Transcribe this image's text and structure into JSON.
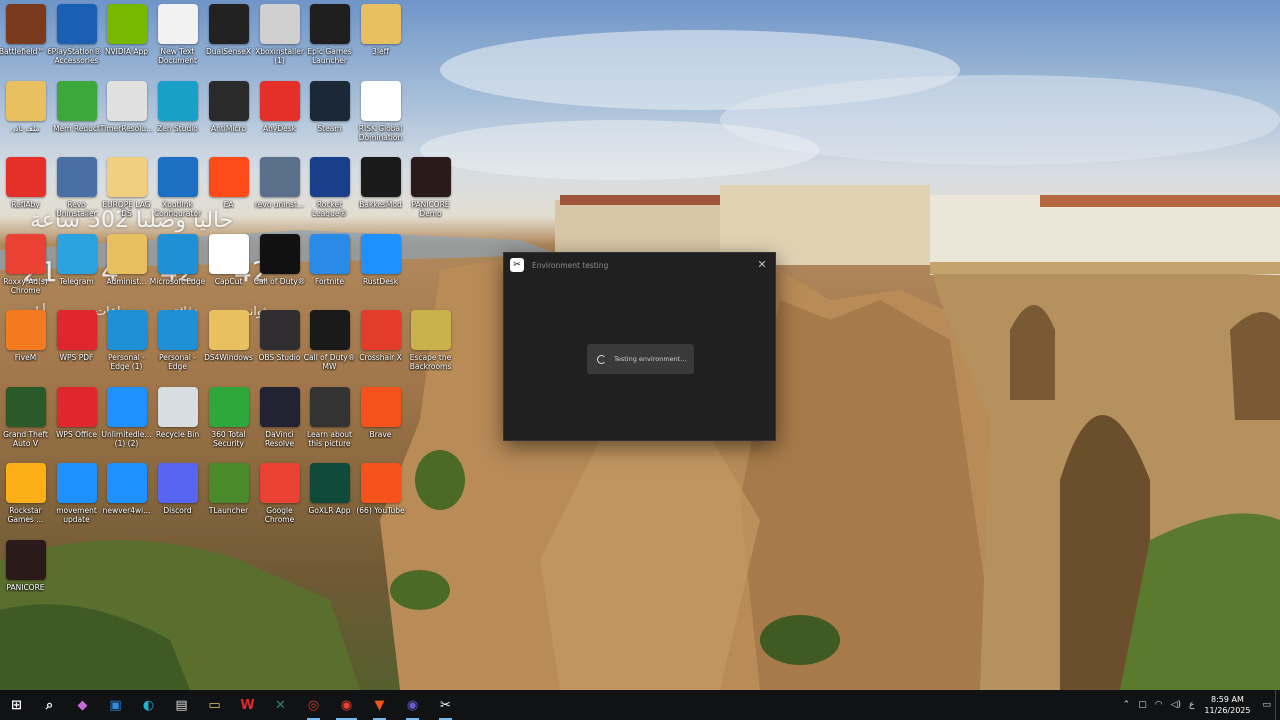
{
  "desktop": {
    "icons": [
      {
        "label": "Battlefield™ 6",
        "icon": "battlefield-icon",
        "color": "#7a3a1e"
      },
      {
        "label": "PlayStation® Accessories",
        "icon": "playstation-icon",
        "color": "#1a5fb4"
      },
      {
        "label": "NVIDIA App",
        "icon": "nvidia-icon",
        "color": "#76b900"
      },
      {
        "label": "New Text Document",
        "icon": "text-file-icon",
        "color": "#f2f2f2"
      },
      {
        "label": "DualSenseX",
        "icon": "dualsense-icon",
        "color": "#222222"
      },
      {
        "label": "Xboxinstaller (1)",
        "icon": "xbox-icon",
        "color": "#cfcfcf"
      },
      {
        "label": "Epic Games Launcher",
        "icon": "epic-games-icon",
        "color": "#1f1f1f"
      },
      {
        "label": "3leff",
        "icon": "folder-icon",
        "color": "#e8c060"
      },
      {
        "label": "ملف نادر",
        "icon": "folder-icon",
        "color": "#e8c060"
      },
      {
        "label": "Mem Reduct",
        "icon": "mem-reduct-icon",
        "color": "#3aa83a"
      },
      {
        "label": "TimerResolu...",
        "icon": "clock-icon",
        "color": "#e0e0e0"
      },
      {
        "label": "Zen Studio",
        "icon": "zen-studio-icon",
        "color": "#19a0c8"
      },
      {
        "label": "AntiMicro",
        "icon": "antimicro-icon",
        "color": "#2a2a2a"
      },
      {
        "label": "AnyDesk",
        "icon": "anydesk-icon",
        "color": "#e5302a"
      },
      {
        "label": "Steam",
        "icon": "steam-icon",
        "color": "#1b2838"
      },
      {
        "label": "RISK Global Domination",
        "icon": "risk-icon",
        "color": "#ffffff"
      },
      {
        "label": "ReflAby",
        "icon": "reflaby-icon",
        "color": "#e5302a"
      },
      {
        "label": "Revo Uninstaller",
        "icon": "revo-icon",
        "color": "#4a6fa5"
      },
      {
        "label": "EUROPE LAG DS",
        "icon": "folder-icon",
        "color": "#f0d080"
      },
      {
        "label": "Xoutlink Configurator",
        "icon": "configurator-icon",
        "color": "#1d6fc4"
      },
      {
        "label": "EA",
        "icon": "ea-icon",
        "color": "#ff4a1a"
      },
      {
        "label": "revo uninst...",
        "icon": "revo-icon",
        "color": "#5a6f8a"
      },
      {
        "label": "Rocket League®",
        "icon": "rocket-league-icon",
        "color": "#1a3f8a"
      },
      {
        "label": "BakkesMod",
        "icon": "bakkesmod-icon",
        "color": "#1a1a1a"
      },
      {
        "label": "PANICORE Demo",
        "icon": "panicore-icon",
        "color": "#2a1a1a"
      },
      {
        "label": "Roxxy Ad(s) Chrome",
        "icon": "chrome-icon",
        "color": "#e94235"
      },
      {
        "label": "Telegram",
        "icon": "telegram-icon",
        "color": "#2aa3e0"
      },
      {
        "label": "Administ...",
        "icon": "folder-icon",
        "color": "#e8c060"
      },
      {
        "label": "Microsoft Edge",
        "icon": "edge-icon",
        "color": "#1f8fd6"
      },
      {
        "label": "CapCut",
        "icon": "capcut-icon",
        "color": "#ffffff"
      },
      {
        "label": "Call of Duty®",
        "icon": "call-of-duty-icon",
        "color": "#111111"
      },
      {
        "label": "Fortnite",
        "icon": "fortnite-icon",
        "color": "#2a8ae8"
      },
      {
        "label": "RustDesk",
        "icon": "rustdesk-icon",
        "color": "#1e90ff"
      },
      {
        "label": "FiveM",
        "icon": "fivem-icon",
        "color": "#f47a20"
      },
      {
        "label": "WPS PDF",
        "icon": "wps-pdf-icon",
        "color": "#e0262e"
      },
      {
        "label": "Personal - Edge (1)",
        "icon": "edge-icon",
        "color": "#1f8fd6"
      },
      {
        "label": "Personal - Edge",
        "icon": "edge-icon",
        "color": "#1f8fd6"
      },
      {
        "label": "DS4Windows",
        "icon": "folder-icon",
        "color": "#e8c060"
      },
      {
        "label": "OBS Studio",
        "icon": "obs-icon",
        "color": "#302e31"
      },
      {
        "label": "Call of Duty® MW",
        "icon": "mw-icon",
        "color": "#1a1a1a"
      },
      {
        "label": "Crosshair X",
        "icon": "crosshair-icon",
        "color": "#e23c2a"
      },
      {
        "label": "Escape the Backrooms",
        "icon": "backrooms-icon",
        "color": "#c9b24a"
      },
      {
        "label": "Grand Theft Auto V",
        "icon": "gta-icon",
        "color": "#2a5a2a"
      },
      {
        "label": "WPS Office",
        "icon": "wps-office-icon",
        "color": "#e0262e"
      },
      {
        "label": "Unlimitedle... (1) (2)",
        "icon": "ie-icon",
        "color": "#1e90ff"
      },
      {
        "label": "Recycle Bin",
        "icon": "recycle-bin-icon",
        "color": "#d8dde2"
      },
      {
        "label": "360 Total Security",
        "icon": "360-security-icon",
        "color": "#2ea83a"
      },
      {
        "label": "DaVinci Resolve",
        "icon": "davinci-icon",
        "color": "#223"
      },
      {
        "label": "Learn about this picture",
        "icon": "camera-icon",
        "color": "#333333"
      },
      {
        "label": "Brave",
        "icon": "brave-icon",
        "color": "#f5521c"
      },
      {
        "label": "Rockstar Games ...",
        "icon": "rockstar-icon",
        "color": "#fcaf17"
      },
      {
        "label": "movement update",
        "icon": "ie-icon",
        "color": "#1e90ff"
      },
      {
        "label": "newver4wi...",
        "icon": "ie-icon",
        "color": "#1e90ff"
      },
      {
        "label": "Discord",
        "icon": "discord-icon",
        "color": "#5865f2"
      },
      {
        "label": "TLauncher",
        "icon": "tlauncher-icon",
        "color": "#4a8a2a"
      },
      {
        "label": "Google Chrome",
        "icon": "chrome-icon",
        "color": "#e94235"
      },
      {
        "label": "GoXLR App",
        "icon": "goxlr-icon",
        "color": "#0f4a3a"
      },
      {
        "label": "(66) YouTube",
        "icon": "brave-icon",
        "color": "#f5521c"
      },
      {
        "label": "PANICORE",
        "icon": "panicore-icon",
        "color": "#2a1a1a"
      }
    ]
  },
  "overlay": {
    "title": "حاليا وصلنا 502 ساعة",
    "days_value": "21",
    "hours_value": "4",
    "minutes_value": "42",
    "seconds_value": "42",
    "days_label": "أيام",
    "hours_label": "ساعات",
    "minutes_label": "دقائق",
    "seconds_label": "ثواني"
  },
  "dialog": {
    "title": "Environment testing",
    "app_logo": "capcut-icon",
    "close_glyph": "✕",
    "status_text": "Testing environment..."
  },
  "taskbar": {
    "items": [
      {
        "name": "start-icon",
        "glyph": "⊞",
        "color": "#ffffff"
      },
      {
        "name": "search-icon",
        "glyph": "⌕",
        "color": "#ffffff"
      },
      {
        "name": "copilot-icon",
        "glyph": "◆",
        "color": "#c86bd8"
      },
      {
        "name": "store-icon",
        "glyph": "▣",
        "color": "#2f8ae0"
      },
      {
        "name": "edge-icon",
        "glyph": "◐",
        "color": "#1fb0d6"
      },
      {
        "name": "store-bag-icon",
        "glyph": "▤",
        "color": "#dcdcdc"
      },
      {
        "name": "file-explorer-icon",
        "glyph": "▭",
        "color": "#e8c060"
      },
      {
        "name": "wps-icon",
        "glyph": "W",
        "color": "#e0262e"
      },
      {
        "name": "goxlr-icon",
        "glyph": "✕",
        "color": "#2b8a6a"
      },
      {
        "name": "crosshair-icon",
        "glyph": "◎",
        "color": "#e23c2a"
      },
      {
        "name": "chrome-icon",
        "glyph": "◉",
        "color": "#e94235"
      },
      {
        "name": "brave-icon",
        "glyph": "▼",
        "color": "#f5521c"
      },
      {
        "name": "chrome-profile-icon",
        "glyph": "◉",
        "color": "#6a5acd"
      },
      {
        "name": "capcut-icon",
        "glyph": "✂",
        "color": "#ffffff"
      }
    ],
    "tray": {
      "chevron": "⌃",
      "input_lang": "ع",
      "time": "8:59 AM",
      "date": "11/26/2025"
    }
  }
}
